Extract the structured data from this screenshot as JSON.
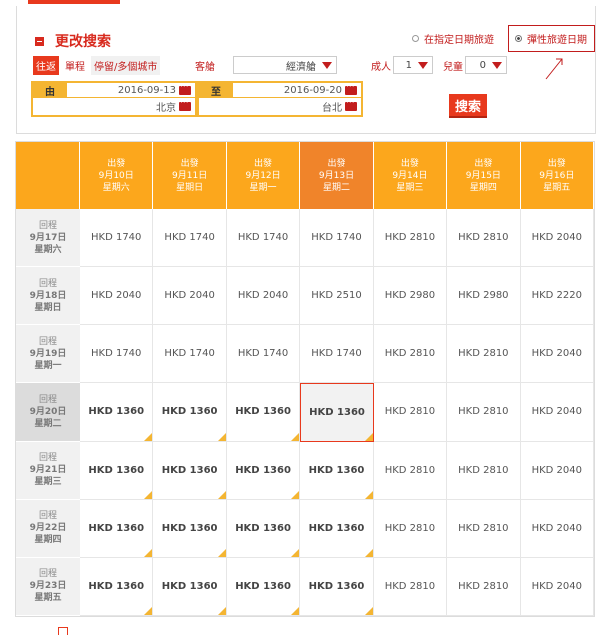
{
  "search": {
    "title": "更改搜索",
    "mode_fixed": "在指定日期旅遊",
    "mode_flexible": "彈性旅遊日期",
    "trip_types": [
      "往返",
      "單程",
      "停留/多個城市"
    ],
    "cabin_label": "客艙",
    "cabin_value": "經濟艙",
    "adults_label": "成人",
    "adults_value": "1",
    "children_label": "兒童",
    "children_value": "0",
    "from_label": "由",
    "from_date": "2016-09-13",
    "from_city": "北京",
    "to_label": "至",
    "to_date": "2016-09-20",
    "to_city": "台北",
    "search_button": "搜索"
  },
  "grid": {
    "columns": [
      {
        "label": "出發",
        "date": "9月10日",
        "day": "星期六"
      },
      {
        "label": "出發",
        "date": "9月11日",
        "day": "星期日"
      },
      {
        "label": "出發",
        "date": "9月12日",
        "day": "星期一"
      },
      {
        "label": "出發",
        "date": "9月13日",
        "day": "星期二"
      },
      {
        "label": "出發",
        "date": "9月14日",
        "day": "星期三"
      },
      {
        "label": "出發",
        "date": "9月15日",
        "day": "星期四"
      },
      {
        "label": "出發",
        "date": "9月16日",
        "day": "星期五"
      }
    ],
    "rows": [
      {
        "label": "回程",
        "date": "9月17日",
        "day": "星期六",
        "prices": [
          "HKD 1740",
          "HKD 1740",
          "HKD 1740",
          "HKD 1740",
          "HKD 2810",
          "HKD 2810",
          "HKD 2040"
        ]
      },
      {
        "label": "回程",
        "date": "9月18日",
        "day": "星期日",
        "prices": [
          "HKD 2040",
          "HKD 2040",
          "HKD 2040",
          "HKD 2510",
          "HKD 2980",
          "HKD 2980",
          "HKD 2220"
        ]
      },
      {
        "label": "回程",
        "date": "9月19日",
        "day": "星期一",
        "prices": [
          "HKD 1740",
          "HKD 1740",
          "HKD 1740",
          "HKD 1740",
          "HKD 2810",
          "HKD 2810",
          "HKD 2040"
        ]
      },
      {
        "label": "回程",
        "date": "9月20日",
        "day": "星期二",
        "prices": [
          "HKD 1360",
          "HKD 1360",
          "HKD 1360",
          "HKD 1360",
          "HKD 2810",
          "HKD 2810",
          "HKD 2040"
        ]
      },
      {
        "label": "回程",
        "date": "9月21日",
        "day": "星期三",
        "prices": [
          "HKD 1360",
          "HKD 1360",
          "HKD 1360",
          "HKD 1360",
          "HKD 2810",
          "HKD 2810",
          "HKD 2040"
        ]
      },
      {
        "label": "回程",
        "date": "9月22日",
        "day": "星期四",
        "prices": [
          "HKD 1360",
          "HKD 1360",
          "HKD 1360",
          "HKD 1360",
          "HKD 2810",
          "HKD 2810",
          "HKD 2040"
        ]
      },
      {
        "label": "回程",
        "date": "9月23日",
        "day": "星期五",
        "prices": [
          "HKD 1360",
          "HKD 1360",
          "HKD 1360",
          "HKD 1360",
          "HKD 2810",
          "HKD 2810",
          "HKD 2040"
        ]
      }
    ],
    "selected_column": 3,
    "selected_row": 3,
    "colors": {
      "header": "#fca71c",
      "header_selected": "#f0842a",
      "accent": "#e8391d",
      "lowest_fare_marker": "#f4b532"
    }
  }
}
